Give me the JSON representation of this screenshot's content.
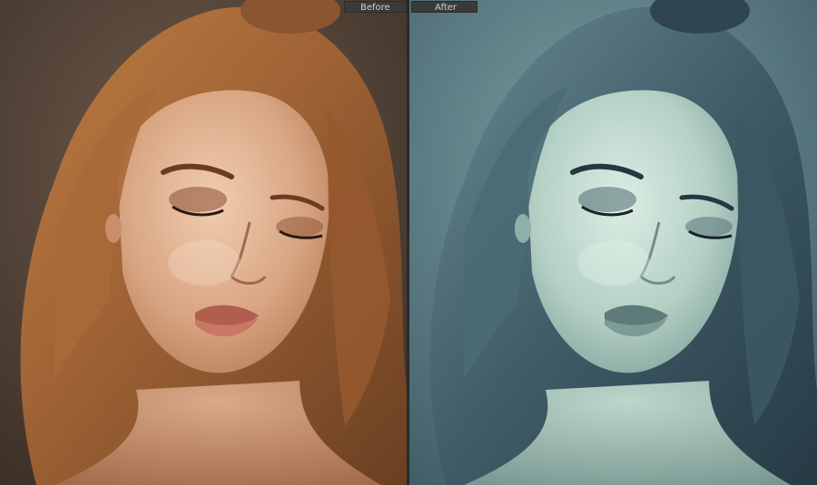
{
  "view": {
    "before_label": "Before",
    "after_label": "After"
  },
  "colors": {
    "before_bg": "#5a4a3e",
    "before_hair": "#a5683a",
    "before_skin": "#dcae8c",
    "after_bg": "#5d8088",
    "after_hair": "#3f5c68",
    "after_skin": "#b7d2c8",
    "divider": "#2a2a2a"
  },
  "icons": {
    "before_photo": "portrait-photo",
    "after_photo": "portrait-photo-teal-toned"
  }
}
